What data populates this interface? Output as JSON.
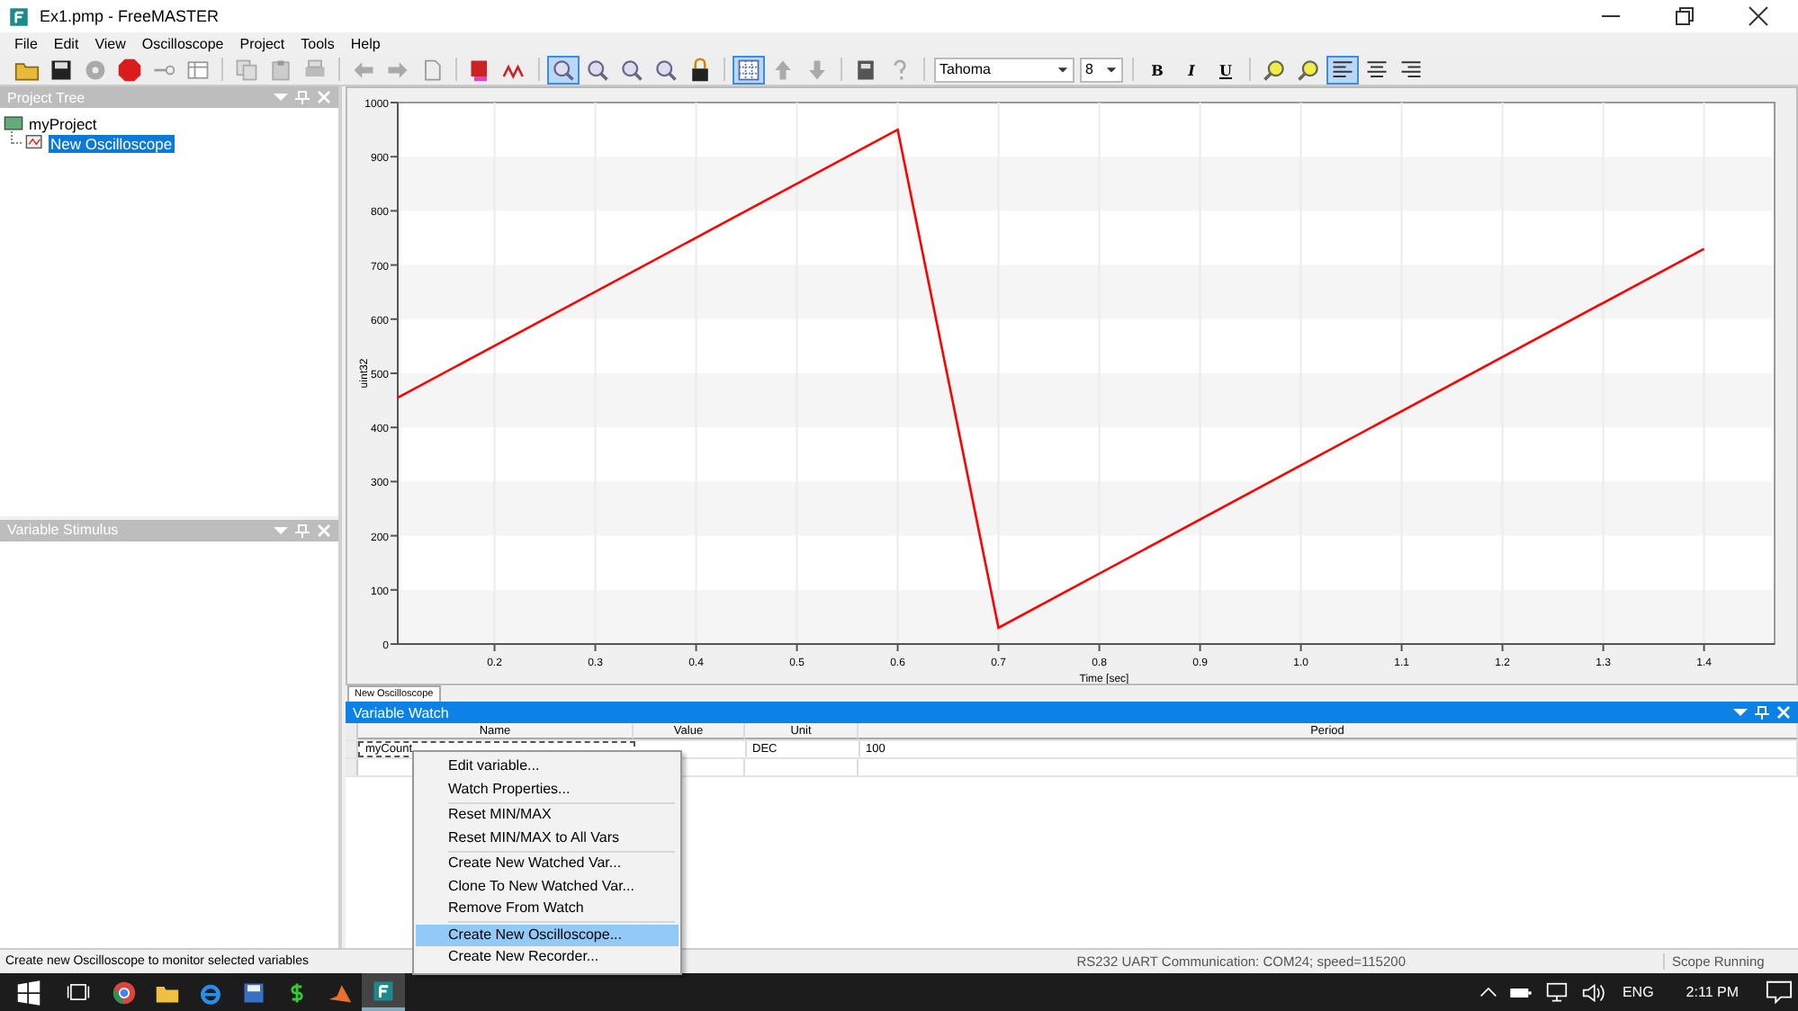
{
  "window": {
    "title": "Ex1.pmp - FreeMASTER"
  },
  "menu": [
    "File",
    "Edit",
    "View",
    "Oscilloscope",
    "Project",
    "Tools",
    "Help"
  ],
  "toolbar": [
    {
      "kind": "open",
      "selected": false
    },
    {
      "kind": "save",
      "selected": false
    },
    {
      "kind": "disc",
      "selected": false
    },
    {
      "kind": "stop",
      "selected": false
    },
    {
      "kind": "key",
      "selected": false
    },
    {
      "kind": "table",
      "selected": false
    },
    {
      "kind": "sep"
    },
    {
      "kind": "copy",
      "selected": false
    },
    {
      "kind": "paste",
      "selected": false
    },
    {
      "kind": "print",
      "selected": false
    },
    {
      "kind": "sep"
    },
    {
      "kind": "back",
      "selected": false
    },
    {
      "kind": "forward",
      "selected": false
    },
    {
      "kind": "page",
      "selected": false
    },
    {
      "kind": "sep"
    },
    {
      "kind": "scope",
      "selected": false
    },
    {
      "kind": "wave",
      "selected": false
    },
    {
      "kind": "sep"
    },
    {
      "kind": "zoom",
      "selected": true
    },
    {
      "kind": "zoom",
      "selected": false
    },
    {
      "kind": "zoom",
      "selected": false
    },
    {
      "kind": "zoom",
      "selected": false
    },
    {
      "kind": "lock",
      "selected": false
    },
    {
      "kind": "sep"
    },
    {
      "kind": "grid",
      "selected": true
    },
    {
      "kind": "up",
      "selected": false
    },
    {
      "kind": "down",
      "selected": false
    },
    {
      "kind": "sep"
    },
    {
      "kind": "calc",
      "selected": false
    },
    {
      "kind": "help",
      "selected": false
    }
  ],
  "font": {
    "family": "Tahoma",
    "size": "8"
  },
  "format_buttons": [
    {
      "label": "B",
      "kind": "bold"
    },
    {
      "label": "I",
      "kind": "italic"
    },
    {
      "label": "U",
      "kind": "underline"
    }
  ],
  "align_buttons": [
    {
      "kind": "find",
      "selected": false
    },
    {
      "kind": "find",
      "selected": false
    },
    {
      "kind": "left",
      "selected": true
    },
    {
      "kind": "center",
      "selected": false
    },
    {
      "kind": "right",
      "selected": false
    }
  ],
  "project_tree": {
    "title": "Project Tree",
    "active": false,
    "items": [
      {
        "label": "myProject",
        "selected": false,
        "children": [
          {
            "label": "New Oscilloscope",
            "selected": true
          }
        ]
      }
    ]
  },
  "variable_stimulus": {
    "title": "Variable Stimulus",
    "active": false
  },
  "chart_data": {
    "type": "line",
    "xlabel": "Time [sec]",
    "ylabel": "uint32",
    "x": [
      0.104,
      0.6,
      0.7,
      1.4
    ],
    "series": [
      {
        "color": "#ff0000",
        "values": [
          455,
          950,
          30,
          730
        ]
      }
    ],
    "xlim": [
      0.104,
      1.47
    ],
    "ylim": [
      0,
      1000
    ],
    "xticks": [
      0.2,
      0.3,
      0.4,
      0.5,
      0.6,
      0.7,
      0.8,
      0.9,
      {
        "value": 1,
        "label": "1.0"
      },
      1.1,
      1.2,
      1.3,
      1.4
    ],
    "yticks": [
      0,
      100,
      200,
      300,
      400,
      500,
      600,
      700,
      800,
      900,
      1000
    ],
    "grid": true
  },
  "chart_tabs": [
    {
      "label": "New Oscilloscope",
      "selected": true
    }
  ],
  "variable_watch": {
    "title": "Variable Watch",
    "active": true,
    "columns": [
      "Name",
      "Value",
      "Unit",
      "Period"
    ],
    "rows": [
      [
        "myCount",
        "",
        "DEC",
        "100"
      ]
    ]
  },
  "context_menu": [
    [
      {
        "label": "Edit variable...",
        "selected": false
      },
      {
        "label": "Watch Properties...",
        "selected": false
      }
    ],
    [
      {
        "label": "Reset MIN/MAX",
        "selected": false
      },
      {
        "label": "Reset MIN/MAX to All Vars",
        "selected": false
      }
    ],
    [
      {
        "label": "Create New Watched Var...",
        "selected": false
      },
      {
        "label": "Clone To New Watched Var...",
        "selected": false
      },
      {
        "label": "Remove From Watch",
        "selected": false
      }
    ],
    [
      {
        "label": "Create New Oscilloscope...",
        "selected": true
      },
      {
        "label": "Create New Recorder...",
        "selected": false
      }
    ]
  ],
  "status_bar": {
    "hint": "Create new Oscilloscope to monitor selected variables",
    "connection": "RS232 UART Communication: COM24; speed=115200",
    "state": "Scope Running"
  },
  "taskbar": {
    "apps": [
      {
        "kind": "chrome",
        "active": false
      },
      {
        "kind": "folder",
        "active": false
      },
      {
        "kind": "ie",
        "active": false
      },
      {
        "kind": "floppy",
        "active": false
      },
      {
        "kind": "dollar",
        "active": false
      },
      {
        "kind": "matlab",
        "active": false
      },
      {
        "kind": "freemaster",
        "active": true
      }
    ],
    "language": "ENG",
    "time": "2:11 PM"
  }
}
